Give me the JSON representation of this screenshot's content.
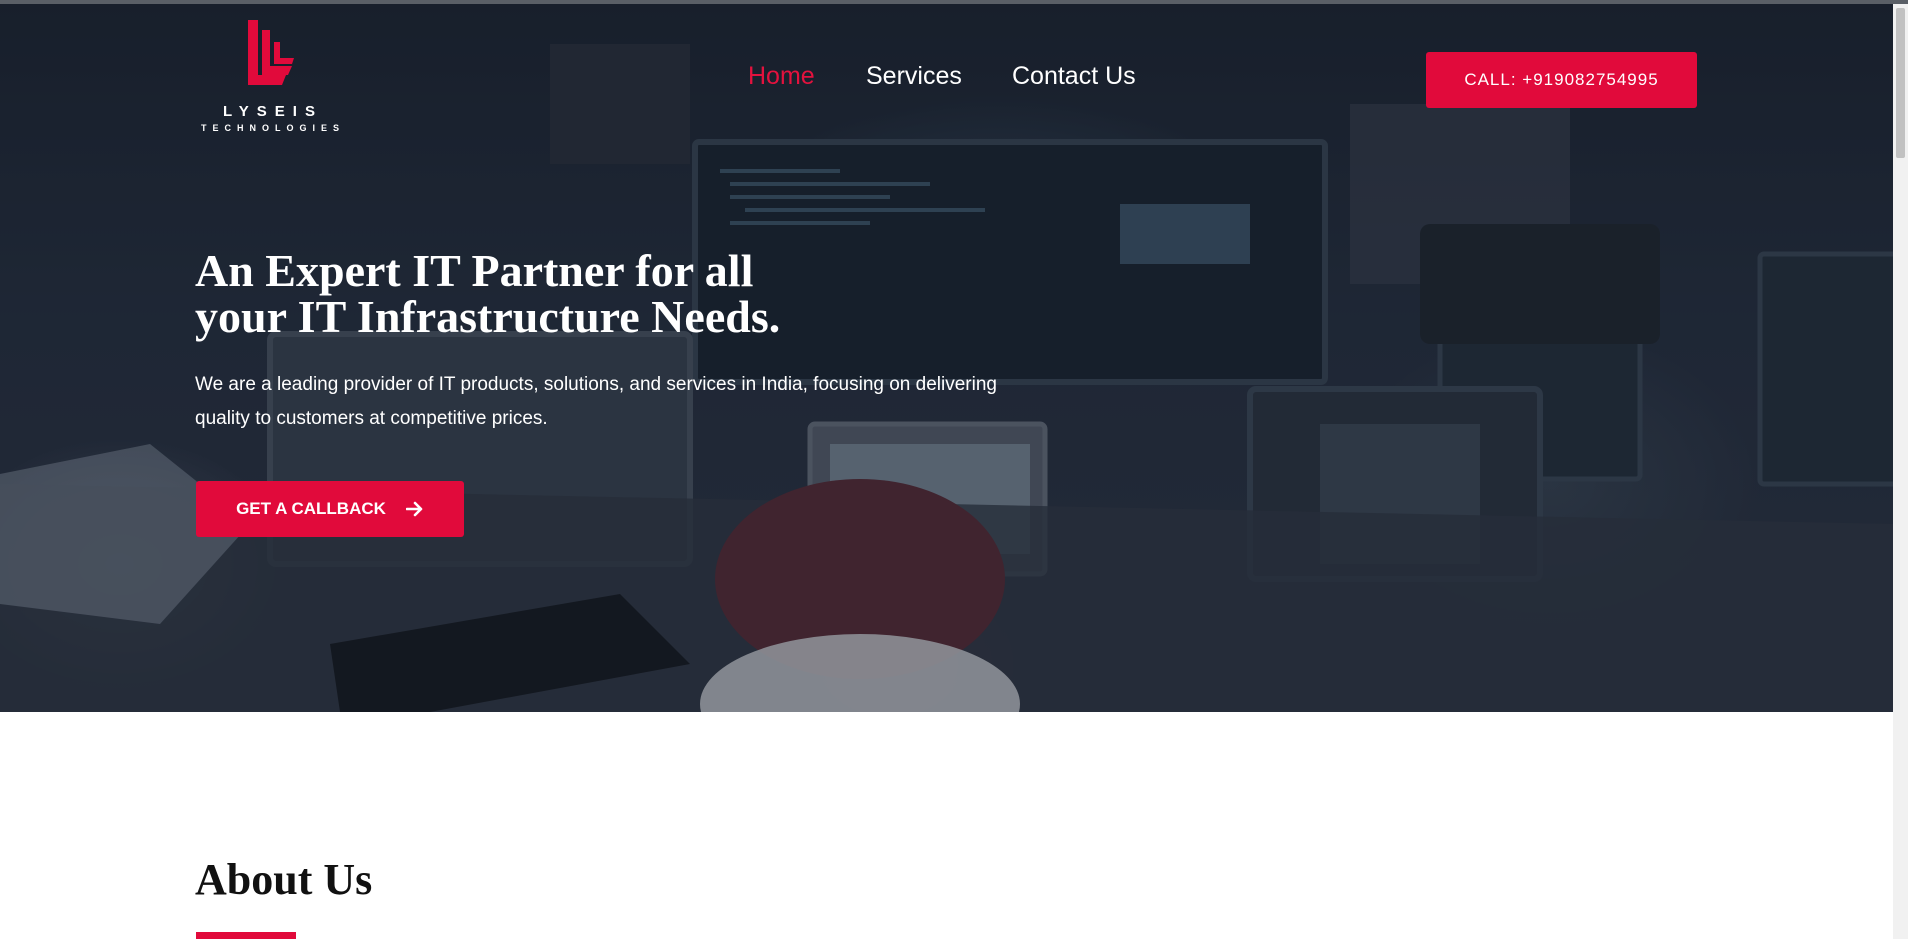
{
  "brand": {
    "name": "LYSEIS",
    "tagline": "TECHNOLOGIES",
    "accent_color": "#e10a3b",
    "icon": "lyseis-logo-mark"
  },
  "nav": {
    "items": [
      {
        "label": "Home",
        "active": true
      },
      {
        "label": "Services",
        "active": false
      },
      {
        "label": "Contact Us",
        "active": false
      }
    ]
  },
  "header": {
    "call_label": "CALL: +919082754995"
  },
  "hero": {
    "title_line1": "An Expert IT Partner for all",
    "title_line2": "your IT Infrastructure Needs.",
    "description": "We are a leading provider of IT products, solutions, and services in India, focusing on delivering quality to customers at competitive prices.",
    "cta_label": "GET A CALLBACK",
    "cta_icon": "arrow-right-icon"
  },
  "about": {
    "title": "About Us"
  }
}
